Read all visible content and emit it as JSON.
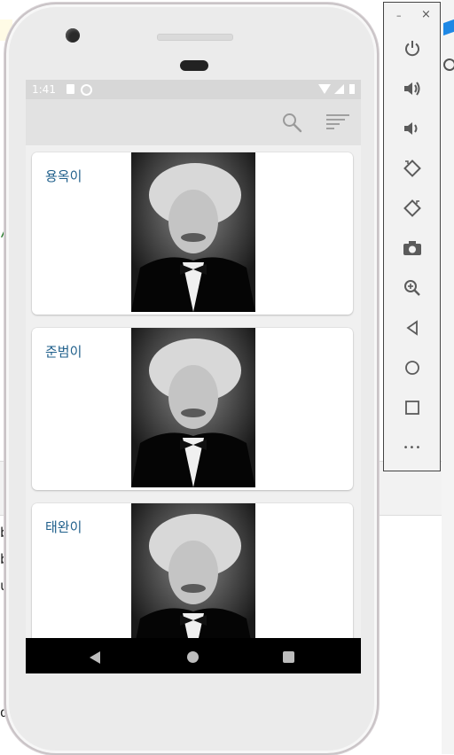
{
  "background": {
    "code_lines": [
      "b",
      "b",
      "u",
      "d"
    ]
  },
  "status_bar": {
    "time": "1:41"
  },
  "app_bar": {
    "icons": [
      "search-icon",
      "sort-icon"
    ]
  },
  "contacts": [
    {
      "name": "용옥이",
      "photo": "portrait-photo"
    },
    {
      "name": "준범이",
      "photo": "portrait-photo"
    },
    {
      "name": "태완이",
      "photo": "portrait-photo"
    }
  ],
  "nav_bar": {
    "icons": [
      "back-icon",
      "home-icon",
      "recents-icon"
    ]
  },
  "emulator_toolbar": {
    "minimize_label": "–",
    "close_label": "×",
    "more_label": "•••",
    "buttons": [
      "power-icon",
      "volume-up-icon",
      "volume-down-icon",
      "rotate-left-icon",
      "rotate-right-icon",
      "camera-icon",
      "zoom-icon",
      "back-icon",
      "home-icon",
      "overview-icon",
      "more-icon"
    ]
  },
  "colors": {
    "name_text": "#1f5f8b",
    "app_bar": "#e2e2e2",
    "status_bar": "#d7d7d7",
    "nav_bar": "#000000"
  }
}
